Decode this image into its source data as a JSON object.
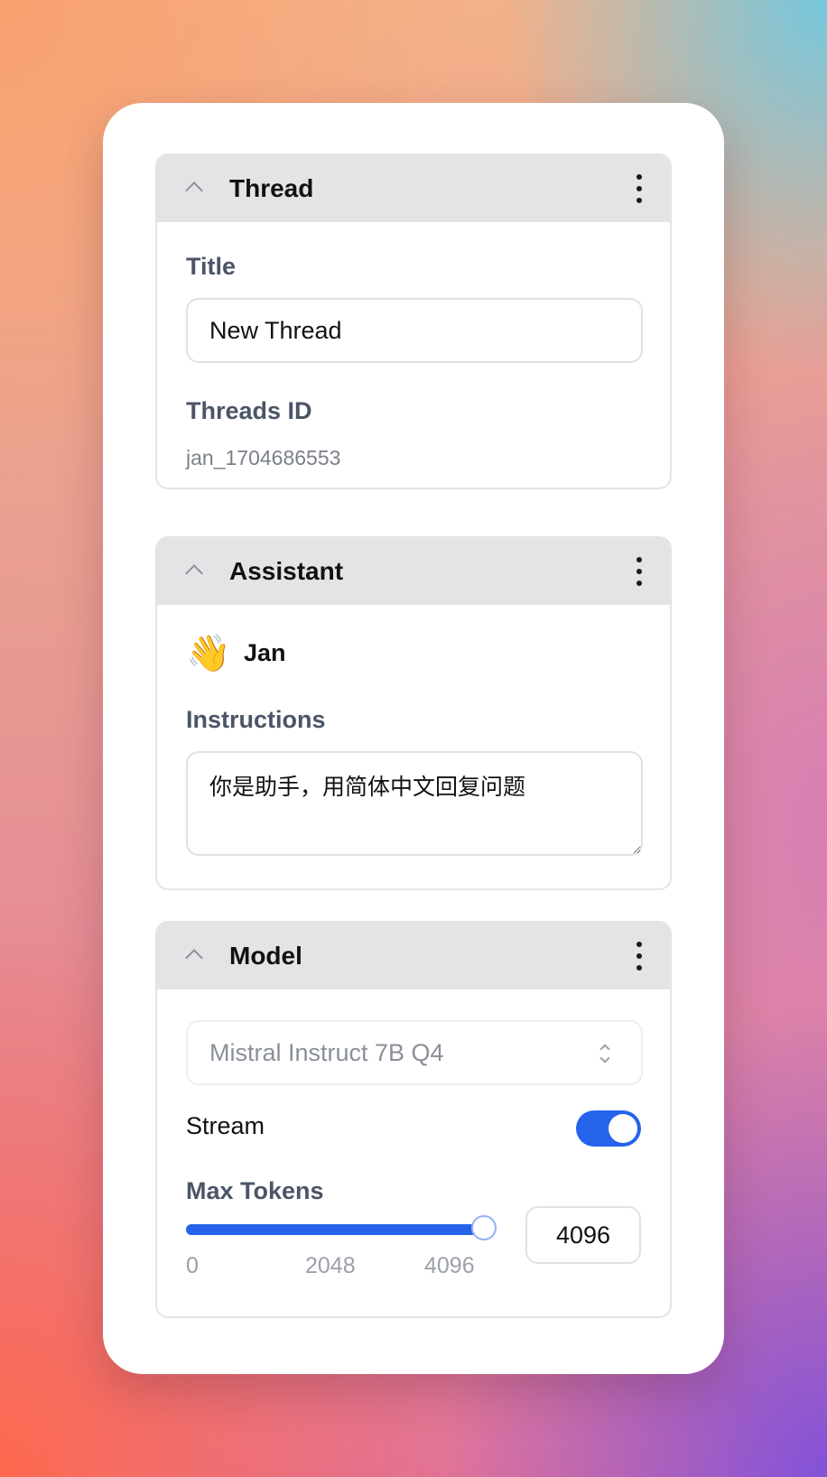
{
  "thread": {
    "header": "Thread",
    "title_label": "Title",
    "title_value": "New Thread",
    "id_label": "Threads ID",
    "id_value": "jan_1704686553"
  },
  "assistant": {
    "header": "Assistant",
    "avatar_emoji": "👋",
    "name": "Jan",
    "instructions_label": "Instructions",
    "instructions_value": "你是助手，用简体中文回复问题"
  },
  "model": {
    "header": "Model",
    "selected_model": "Mistral Instruct 7B Q4",
    "stream_label": "Stream",
    "stream_enabled": true,
    "max_tokens_label": "Max Tokens",
    "max_tokens_min": "0",
    "max_tokens_mid": "2048",
    "max_tokens_max": "4096",
    "max_tokens_value": "4096",
    "max_tokens_fraction": 1.0
  },
  "colors": {
    "accent": "#2563eb",
    "header_bg": "#e4e4e7",
    "label": "#4b5567"
  },
  "icons": {
    "collapse": "chevron-up-icon",
    "menu": "more-vertical-icon",
    "select": "chevrons-up-down-icon",
    "resize": "resize-handle-icon"
  }
}
